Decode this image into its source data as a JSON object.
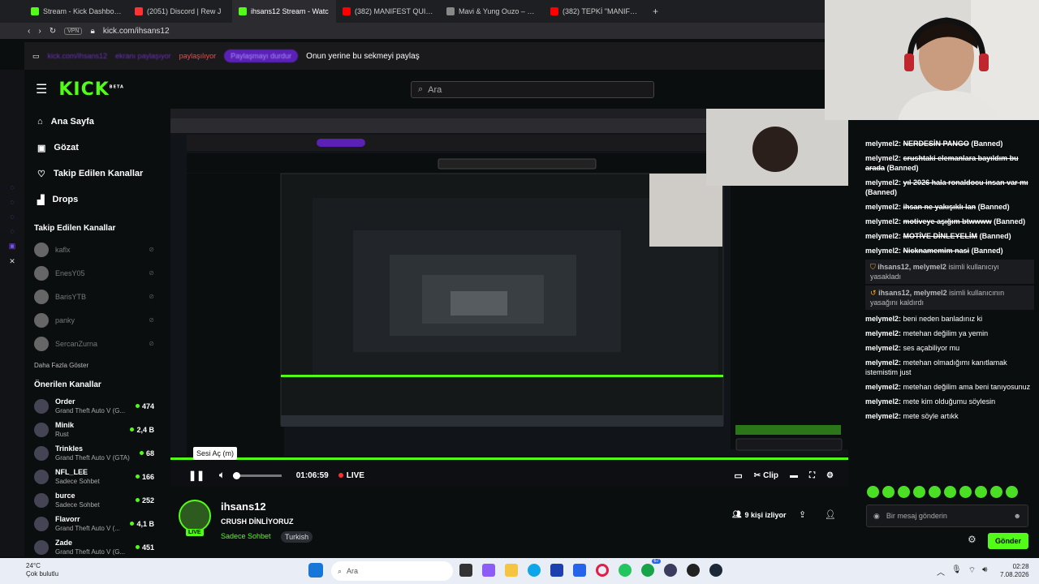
{
  "browser": {
    "tabs": [
      {
        "label": "Stream - Kick Dashboard",
        "color": "#53fc18"
      },
      {
        "label": "(2051) Discord | Rew J",
        "color": "#ff3333"
      },
      {
        "label": "ihsans12 Stream - Watc",
        "color": "#53fc18",
        "active": true
      },
      {
        "label": "(382) MANIFEST QUIZ: Ge",
        "color": "#ff0000"
      },
      {
        "label": "Mavi & Yung Ouzo – MSG",
        "color": "#888888"
      },
      {
        "label": "(382) TEPKİ \"MANIFEST -",
        "color": "#ff0000"
      }
    ],
    "new_tab": "+",
    "vpn": "VPN",
    "url": "kick.com/ihsans12"
  },
  "share_bar": {
    "blurred_1": "kick.com/ihsans12",
    "blurred_2": "ekranı paylaşıyor",
    "sharing": "paylaşılıyor",
    "pill": "Paylaşmayı durdur",
    "message": "Onun yerine bu sekmeyi paylaş"
  },
  "header": {
    "logo": "KICK",
    "logo_sup": "BETA",
    "search_placeholder": "Ara"
  },
  "sidebar": {
    "nav": [
      {
        "label": "Ana Sayfa",
        "icon": "home-icon",
        "glyph": "⌂"
      },
      {
        "label": "Gözat",
        "icon": "browse-icon",
        "glyph": "▣"
      },
      {
        "label": "Takip Edilen Kanallar",
        "icon": "heart-icon",
        "glyph": "♡"
      },
      {
        "label": "Drops",
        "icon": "drops-icon",
        "glyph": "▟"
      }
    ],
    "following_title": "Takip Edilen Kanallar",
    "following": [
      "kaflx",
      "EnesY05",
      "BarisYTB",
      "panky",
      "SercanZurna"
    ],
    "more": "Daha Fazla Göster",
    "recommended_title": "Önerilen Kanallar",
    "recommended": [
      {
        "name": "Order",
        "game": "Grand Theft Auto V (G...",
        "viewers": "474"
      },
      {
        "name": "Minik",
        "game": "Rust",
        "viewers": "2,4 B"
      },
      {
        "name": "Trinkles",
        "game": "Grand Theft Auto V (GTA)",
        "viewers": "68"
      },
      {
        "name": "NFL_LEE",
        "game": "Sadece Sohbet",
        "viewers": "166"
      },
      {
        "name": "burce",
        "game": "Sadece Sohbet",
        "viewers": "252"
      },
      {
        "name": "Flavorr",
        "game": "Grand Theft Auto V (...",
        "viewers": "4,1 B"
      },
      {
        "name": "Zade",
        "game": "Grand Theft Auto V (G...",
        "viewers": "451"
      }
    ]
  },
  "player": {
    "tooltip": "Sesi Aç (m)",
    "time": "01:06:59",
    "live": "LIVE",
    "clip": "Clip",
    "progress": 1.0
  },
  "stream": {
    "channel": "ihsans12",
    "title": "CRUSH DİNLİYORUZ",
    "category": "Sadece Sohbet",
    "language": "Turkish",
    "viewers": "9 kişi izliyor",
    "live": "LIVE"
  },
  "chat": {
    "messages": [
      {
        "user": "melymel2:",
        "text": "NERDESİN PANGO",
        "tag": "(Banned)"
      },
      {
        "user": "melymel2:",
        "text": "crushtaki elemanlara bayıldım bu arada",
        "tag": "(Banned)"
      },
      {
        "user": "melymel2:",
        "text": "yıl 2026 hala ronaldocu insan var mı",
        "tag": "(Banned)"
      },
      {
        "user": "melymel2:",
        "text": "ihsan ne yakışıklı lan",
        "tag": "(Banned)"
      },
      {
        "user": "melymel2:",
        "text": "motiveye aşığım btwwww",
        "tag": "(Banned)"
      },
      {
        "user": "melymel2:",
        "text": "MOTİVE DİNLEYELİM",
        "tag": "(Banned)"
      },
      {
        "user": "melymel2:",
        "text": "Nicknamemim nasi",
        "tag": "(Banned)"
      }
    ],
    "system": [
      {
        "who": "ihsans12, melymel2",
        "text": "isimli kullanıcıyı yasakladı"
      },
      {
        "who": "ihsans12, melymel2",
        "text": "isimli kullanıcının yasağını kaldırdı"
      }
    ],
    "messages2": [
      {
        "user": "melymel2:",
        "text": "beni neden banladınız ki"
      },
      {
        "user": "melymel2:",
        "text": "metehan değilim ya yemin"
      },
      {
        "user": "melymel2:",
        "text": "ses açabiliyor mu"
      },
      {
        "user": "melymel2:",
        "text": "metehan olmadığımı kanıtlamak istemistim just"
      },
      {
        "user": "melymel2:",
        "text": "metehan değilim ama beni tanıyosunuz"
      },
      {
        "user": "melymel2:",
        "text": "mete kim olduğumu söylesin"
      },
      {
        "user": "melymel2:",
        "text": "mete söyle artıkk"
      }
    ],
    "input_placeholder": "Bir mesaj gönderin",
    "send": "Gönder"
  },
  "taskbar": {
    "temp": "24°C",
    "weather": "Çok bulutlu",
    "search": "Ara",
    "time": "02:28",
    "date": "7.08.2026",
    "badge": "67"
  },
  "colors": {
    "accent": "#53fc18",
    "bg": "#0b0e0f"
  }
}
